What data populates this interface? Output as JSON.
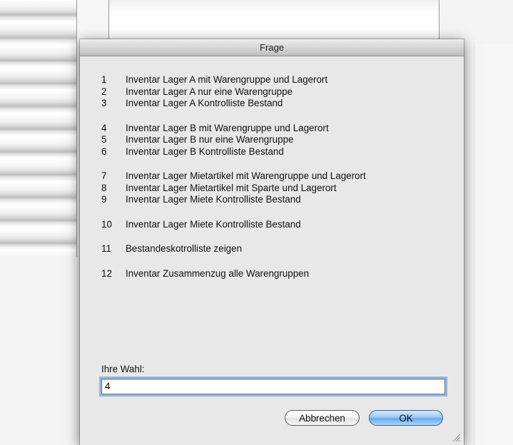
{
  "dialog": {
    "title": "Frage",
    "option_groups": [
      [
        {
          "number": "1",
          "label": "Inventar Lager A mit Warengruppe und Lagerort"
        },
        {
          "number": "2",
          "label": "Inventar Lager A nur eine Warengruppe"
        },
        {
          "number": "3",
          "label": "Inventar Lager A Kontrolliste Bestand"
        }
      ],
      [
        {
          "number": "4",
          "label": "Inventar Lager B mit Warengruppe und Lagerort"
        },
        {
          "number": "5",
          "label": "Inventar Lager B nur eine Warengruppe"
        },
        {
          "number": "6",
          "label": "Inventar Lager B Kontrolliste Bestand"
        }
      ],
      [
        {
          "number": "7",
          "label": "Inventar Lager Mietartikel mit Warengruppe und Lagerort"
        },
        {
          "number": "8",
          "label": "Inventar Lager Mietartikel mit Sparte und Lagerort"
        },
        {
          "number": "9",
          "label": "Inventar Lager Miete Kontrolliste Bestand"
        }
      ],
      [
        {
          "number": "10",
          "label": "Inventar Lager Miete Kontrolliste Bestand"
        }
      ],
      [
        {
          "number": "11",
          "label": "Bestandeskotrolliste zeigen"
        }
      ],
      [
        {
          "number": "12",
          "label": "Inventar Zusammenzug alle Warengruppen"
        }
      ]
    ],
    "prompt_label": "Ihre Wahl:",
    "input_value": "4",
    "cancel_label": "Abbrechen",
    "ok_label": "OK",
    "resize_grip_icon": "resize-grip-icon"
  }
}
